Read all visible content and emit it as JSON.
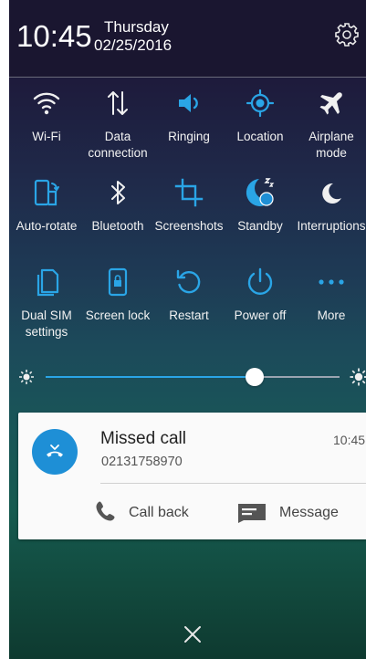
{
  "status": {
    "time": "10:45",
    "day": "Thursday",
    "date": "02/25/2016"
  },
  "quick_settings": [
    {
      "label": [
        "Wi-Fi"
      ],
      "icon": "wifi-icon"
    },
    {
      "label": [
        "Data",
        "connection"
      ],
      "icon": "data-connection-icon"
    },
    {
      "label": [
        "Ringing"
      ],
      "icon": "speaker-icon"
    },
    {
      "label": [
        "Location"
      ],
      "icon": "location-icon"
    },
    {
      "label": [
        "Airplane",
        "mode"
      ],
      "icon": "airplane-icon"
    },
    {
      "label": [
        "Auto-rotate"
      ],
      "icon": "auto-rotate-icon"
    },
    {
      "label": [
        "Bluetooth"
      ],
      "icon": "bluetooth-icon"
    },
    {
      "label": [
        "Screenshots"
      ],
      "icon": "crop-icon"
    },
    {
      "label": [
        "Standby"
      ],
      "icon": "standby-icon"
    },
    {
      "label": [
        "Interruptions"
      ],
      "icon": "moon-icon"
    },
    {
      "label": [
        "Dual SIM",
        "settings"
      ],
      "icon": "dual-sim-icon"
    },
    {
      "label": [
        "Screen lock"
      ],
      "icon": "lock-icon"
    },
    {
      "label": [
        "Restart"
      ],
      "icon": "restart-icon"
    },
    {
      "label": [
        "Power off"
      ],
      "icon": "power-icon"
    },
    {
      "label": [
        "More"
      ],
      "icon": "more-icon"
    }
  ],
  "brightness": {
    "level": 0.71
  },
  "notification": {
    "title": "Missed call",
    "number": "02131758970",
    "time": "10:45",
    "actions": {
      "call_back": "Call back",
      "message": "Message"
    }
  },
  "colors": {
    "accent": "#2aa5e6",
    "avatar": "#1e8fd6"
  }
}
